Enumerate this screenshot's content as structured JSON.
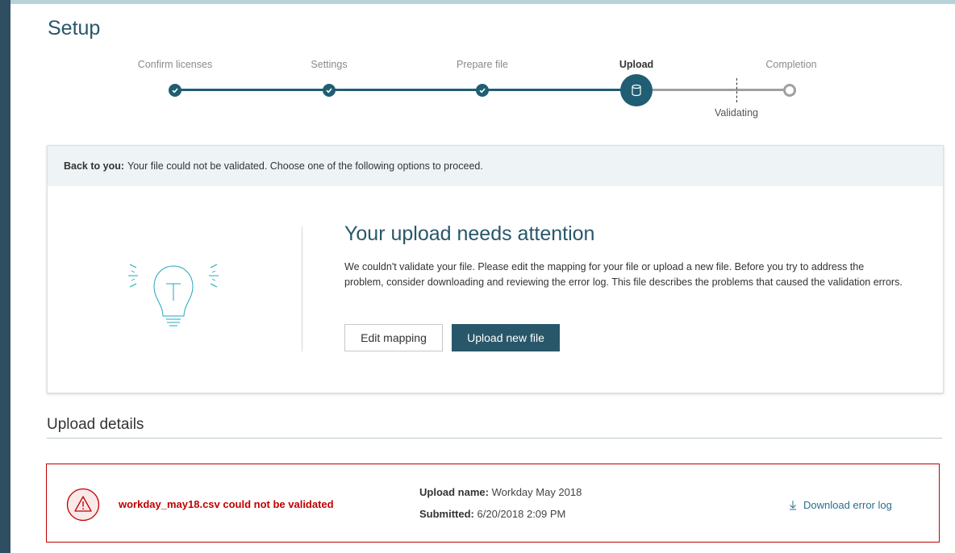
{
  "page": {
    "title": "Setup"
  },
  "stepper": {
    "steps": [
      {
        "label": "Confirm licenses",
        "state": "complete"
      },
      {
        "label": "Settings",
        "state": "complete"
      },
      {
        "label": "Prepare file",
        "state": "complete"
      },
      {
        "label": "Upload",
        "state": "active"
      },
      {
        "label": "Completion",
        "state": "pending"
      }
    ],
    "substep_label": "Validating"
  },
  "attention": {
    "banner_prefix": "Back to you:",
    "banner_text": "Your file could not be validated. Choose one of the following options to proceed.",
    "title": "Your upload needs attention",
    "body": "We couldn't validate your file. Please edit the mapping for your file or upload a new file. Before you try to address the problem, consider downloading and reviewing the error log. This file describes the problems that caused the validation errors.",
    "edit_button": "Edit mapping",
    "upload_button": "Upload new file",
    "illustration_icon": "lightbulb-icon"
  },
  "upload_details": {
    "section_title": "Upload details",
    "error_message": "workday_may18.csv could not be validated",
    "upload_name_label": "Upload name:",
    "upload_name_value": "Workday May 2018",
    "submitted_label": "Submitted:",
    "submitted_value": "6/20/2018 2:09 PM",
    "download_link": "Download error log"
  },
  "colors": {
    "accent": "#28576a",
    "step_complete": "#1f5e73",
    "step_pending": "#a0a0a0",
    "error": "#c00000",
    "link": "#2b6f8a",
    "banner_bg": "#eef4f5"
  }
}
